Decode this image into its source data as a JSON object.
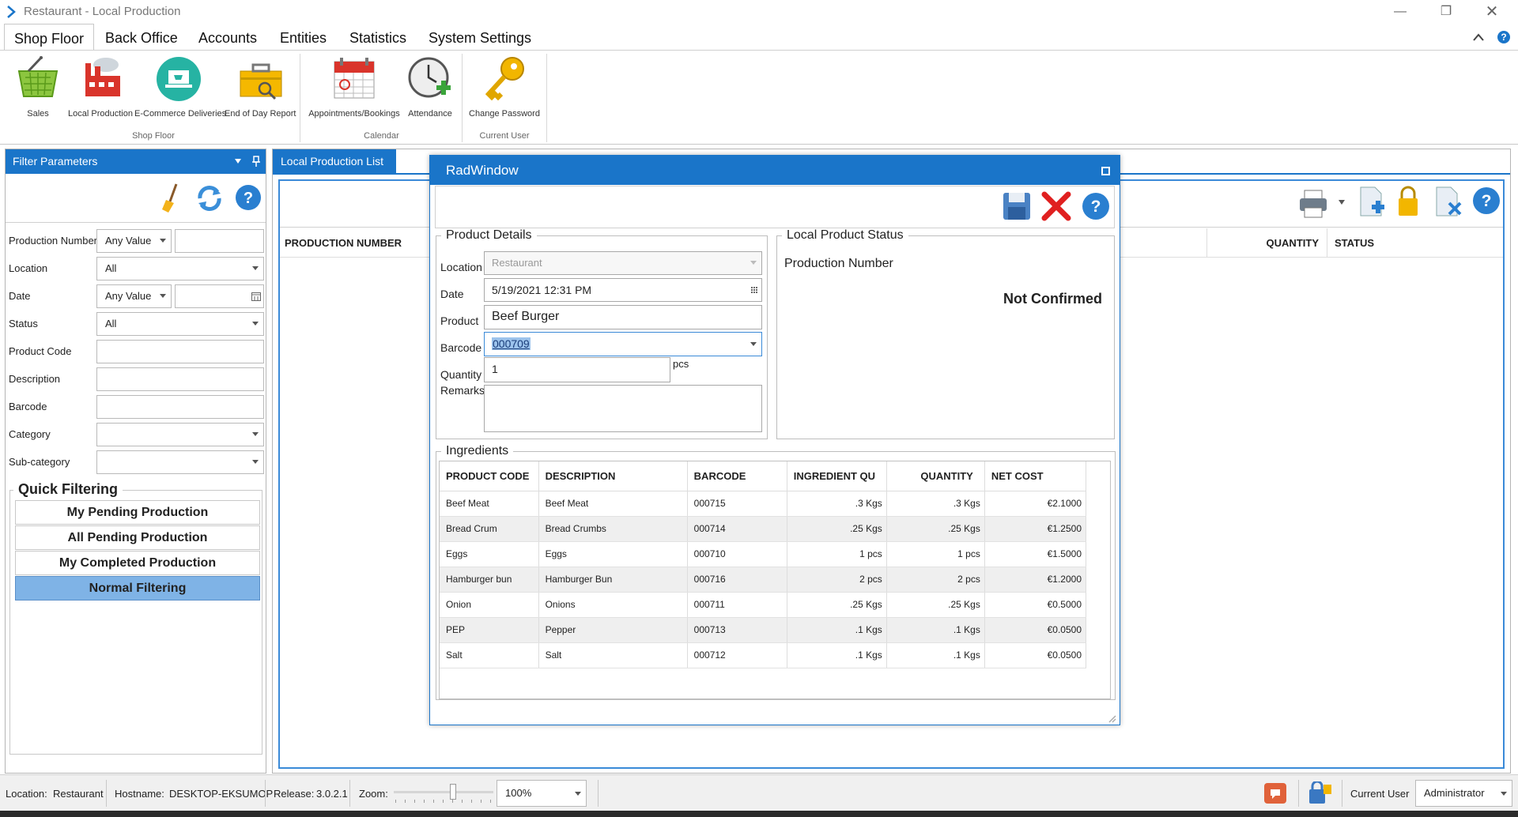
{
  "window": {
    "title": "Restaurant - Local Production"
  },
  "menu": {
    "tabs": [
      "Shop Floor",
      "Back Office",
      "Accounts",
      "Entities",
      "Statistics",
      "System Settings"
    ],
    "active": "Shop Floor"
  },
  "ribbon": {
    "buttons": [
      "Sales",
      "Local Production",
      "E-Commerce Deliveries",
      "End of Day Report",
      "Appointments/Bookings",
      "Attendance",
      "Change Password"
    ],
    "groups": [
      "Shop Floor",
      "Calendar",
      "Current User"
    ]
  },
  "filter": {
    "title": "Filter Parameters",
    "labels": [
      "Production Number",
      "Location",
      "Date",
      "Status",
      "Product Code",
      "Description",
      "Barcode",
      "Category",
      "Sub-category"
    ],
    "production_number_mode": "Any Value",
    "location": "All",
    "date_mode": "Any Value",
    "status": "All",
    "quick_title": "Quick Filtering",
    "quick": [
      "My Pending Production",
      "All Pending Production",
      "My Completed Production",
      "Normal Filtering"
    ]
  },
  "list": {
    "tab": "Local Production List",
    "headers": {
      "production_number": "PRODUCTION NUMBER",
      "quantity": "QUANTITY",
      "status": "STATUS"
    }
  },
  "dialog": {
    "title": "RadWindow",
    "details_legend": "Product Details",
    "status_legend": "Local Product Status",
    "labels": {
      "location": "Location",
      "date": "Date",
      "product": "Product",
      "barcode": "Barcode",
      "quantity": "Quantity",
      "remarks": "Remarks",
      "unit": "pcs"
    },
    "location": "Restaurant",
    "date": "5/19/2021 12:31 PM",
    "product": "Beef Burger",
    "barcode": "000709",
    "quantity": "1",
    "production_number_label": "Production Number",
    "confirm_status": "Not Confirmed",
    "ingredients_legend": "Ingredients",
    "columns": [
      "PRODUCT CODE",
      "DESCRIPTION",
      "BARCODE",
      "INGREDIENT QU",
      "QUANTITY",
      "NET COST"
    ],
    "rows": [
      [
        "Beef Meat",
        "Beef Meat",
        "000715",
        ".3 Kgs",
        ".3 Kgs",
        "€2.1000"
      ],
      [
        "Bread Crum",
        "Bread Crumbs",
        "000714",
        ".25 Kgs",
        ".25 Kgs",
        "€1.2500"
      ],
      [
        "Eggs",
        "Eggs",
        "000710",
        "1 pcs",
        "1 pcs",
        "€1.5000"
      ],
      [
        "Hamburger bun",
        "Hamburger Bun",
        "000716",
        "2 pcs",
        "2 pcs",
        "€1.2000"
      ],
      [
        "Onion",
        "Onions",
        "000711",
        ".25 Kgs",
        ".25 Kgs",
        "€0.5000"
      ],
      [
        "PEP",
        "Pepper",
        "000713",
        ".1 Kgs",
        ".1 Kgs",
        "€0.0500"
      ],
      [
        "Salt",
        "Salt",
        "000712",
        ".1 Kgs",
        ".1 Kgs",
        "€0.0500"
      ]
    ]
  },
  "statusbar": {
    "location_label": "Location:",
    "location": "Restaurant",
    "hostname_label": "Hostname:",
    "hostname": "DESKTOP-EKSUMOP",
    "release_label": "Release:",
    "release": "3.0.2.1",
    "zoom_label": "Zoom:",
    "zoom_level": 0.6,
    "zoom": "100%",
    "user_label": "Current User",
    "user": "Administrator"
  },
  "colors": {
    "accent": "#1a75c9",
    "selected": "#7fb3e6",
    "delete": "#e02020"
  }
}
